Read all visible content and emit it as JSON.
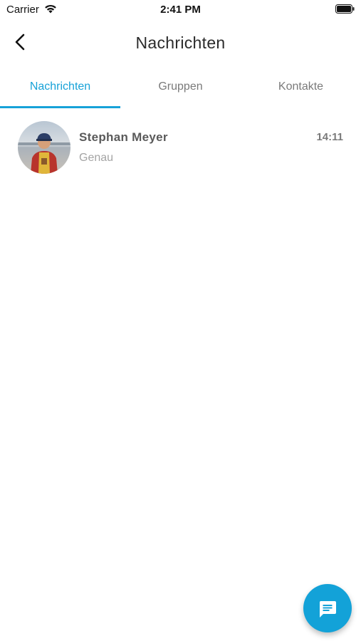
{
  "status_bar": {
    "carrier": "Carrier",
    "time": "2:41 PM",
    "icons": [
      "wifi-icon",
      "battery-icon"
    ]
  },
  "nav": {
    "title": "Nachrichten",
    "back_icon": "chevron-left-icon"
  },
  "tabs": [
    {
      "label": "Nachrichten",
      "active": true
    },
    {
      "label": "Gruppen",
      "active": false
    },
    {
      "label": "Kontakte",
      "active": false
    }
  ],
  "conversations": [
    {
      "name": "Stephan Meyer",
      "time": "14:11",
      "preview": "Genau",
      "avatar": "user-photo"
    }
  ],
  "fab": {
    "icon": "chat-bubble-icon"
  },
  "colors": {
    "accent": "#17a2d8",
    "fab_background": "#13a2d8",
    "title_text": "#2b2b2b",
    "inactive_tab": "#7a7a7a",
    "preview_text": "#a4a4a4"
  }
}
